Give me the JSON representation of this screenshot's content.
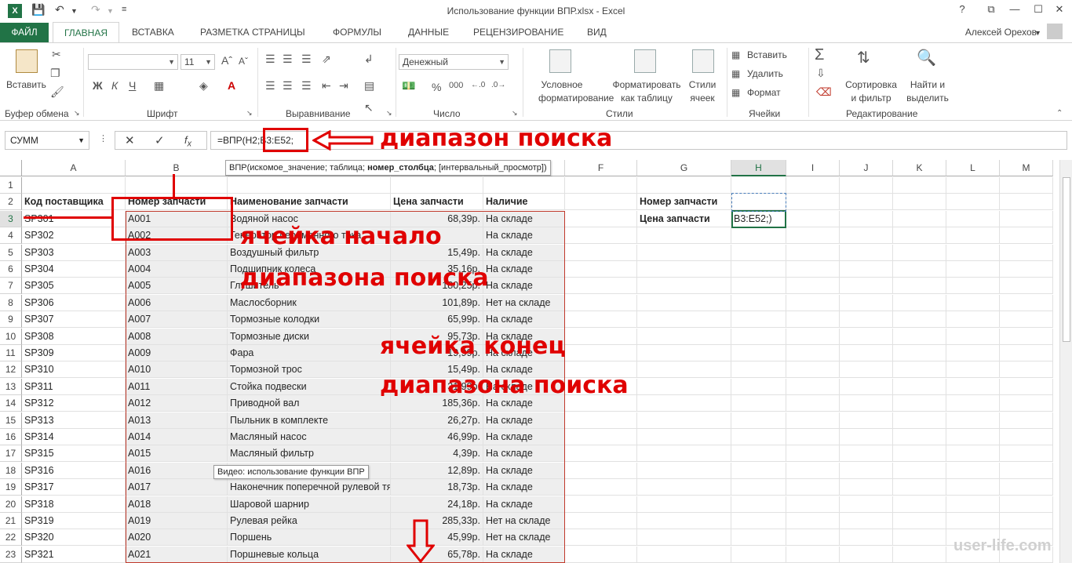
{
  "window": {
    "title": "Использование функции ВПР.xlsx - Excel",
    "app_badge": "X",
    "controls": [
      "?",
      "⧉",
      "—",
      "☐",
      "✕"
    ]
  },
  "tabs": {
    "file": "ФАЙЛ",
    "active": "ГЛАВНАЯ",
    "items": [
      "ВСТАВКА",
      "РАЗМЕТКА СТРАНИЦЫ",
      "ФОРМУЛЫ",
      "ДАННЫЕ",
      "РЕЦЕНЗИРОВАНИЕ",
      "ВИД"
    ],
    "user": "Алексей Орехов"
  },
  "ribbon": {
    "clipboard": {
      "paste": "Вставить",
      "label": "Буфер обмена"
    },
    "font": {
      "size": "11",
      "label": "Шрифт",
      "bold": "Ж",
      "italic": "К",
      "underline": "Ч"
    },
    "alignment": {
      "label": "Выравнивание"
    },
    "number": {
      "format": "Денежный",
      "label": "Число",
      "percent": "%",
      "thousands": "000"
    },
    "styles": {
      "conditional": "Условное форматирование",
      "as_table": "Форматировать как таблицу",
      "cell_styles": "Стили ячеек",
      "label": "Стили"
    },
    "cells": {
      "insert": "Вставить",
      "delete": "Удалить",
      "format": "Формат",
      "label": "Ячейки"
    },
    "editing": {
      "sort": "Сортировка и фильтр",
      "find": "Найти и выделить",
      "label": "Редактирование"
    }
  },
  "formula_bar": {
    "name_box": "СУММ",
    "formula_prefix": "=ВПР(H2;",
    "formula_range": "B3:E52;",
    "tooltip_pre": "ВПР(искомое_значение; таблица; ",
    "tooltip_bold": "номер_столбца",
    "tooltip_post": "; [интервальный_просмотр])"
  },
  "columns": [
    "A",
    "B",
    "C",
    "D",
    "E",
    "F",
    "G",
    "H",
    "I",
    "J",
    "K",
    "L",
    "M"
  ],
  "headers": {
    "a": "Код поставщика",
    "b": "Номер запчасти",
    "c": "Наименование запчасти",
    "d": "Цена запчасти",
    "e": "Наличие"
  },
  "side": {
    "g2": "Номер запчасти",
    "g3": "Цена запчасти",
    "h3": "B3:E52;)"
  },
  "rows": [
    [
      "SP301",
      "A001",
      "Водяной насос",
      "68,39р.",
      "На складе"
    ],
    [
      "SP302",
      "A002",
      "Генератор переменного тока",
      "",
      "На складе"
    ],
    [
      "SP303",
      "A003",
      "Воздушный фильтр",
      "15,49р.",
      "На складе"
    ],
    [
      "SP304",
      "A004",
      "Подшипник колеса",
      "35,16р.",
      "На складе"
    ],
    [
      "SP305",
      "A005",
      "Глушитель",
      "180,25р.",
      "На складе"
    ],
    [
      "SP306",
      "A006",
      "Маслосборник",
      "101,89р.",
      "Нет на складе"
    ],
    [
      "SP307",
      "A007",
      "Тормозные колодки",
      "65,99р.",
      "На складе"
    ],
    [
      "SP308",
      "A008",
      "Тормозные диски",
      "95,73р.",
      "На складе"
    ],
    [
      "SP309",
      "A009",
      "Фара",
      "19,99р.",
      "На складе"
    ],
    [
      "SP310",
      "A010",
      "Тормозной трос",
      "15,49р.",
      "На складе"
    ],
    [
      "SP311",
      "A011",
      "Стойка подвески",
      "31,99р.",
      "На складе"
    ],
    [
      "SP312",
      "A012",
      "Приводной вал",
      "185,36р.",
      "На складе"
    ],
    [
      "SP313",
      "A013",
      "Пыльник в комплекте",
      "26,27р.",
      "На складе"
    ],
    [
      "SP314",
      "A014",
      "Масляный насос",
      "46,99р.",
      "На складе"
    ],
    [
      "SP315",
      "A015",
      "Масляный фильтр",
      "4,39р.",
      "На складе"
    ],
    [
      "SP316",
      "A016",
      "",
      "12,89р.",
      "На складе"
    ],
    [
      "SP317",
      "A017",
      "Наконечник поперечной рулевой тяги",
      "18,73р.",
      "На складе"
    ],
    [
      "SP318",
      "A018",
      "Шаровой шарнир",
      "24,18р.",
      "На складе"
    ],
    [
      "SP319",
      "A019",
      "Рулевая рейка",
      "285,33р.",
      "Нет на складе"
    ],
    [
      "SP320",
      "A020",
      "Поршень",
      "45,99р.",
      "Нет на складе"
    ],
    [
      "SP321",
      "A021",
      "Поршневые кольца",
      "65,78р.",
      "На складе"
    ]
  ],
  "annotations": {
    "search_range": "диапазон поиска",
    "start_1": "ячейка начало",
    "start_2": "диапазона поиска",
    "end_1": "ячейка конец",
    "end_2": "диапазона поиска"
  },
  "video_tip": "Видео: использование функции ВПР",
  "watermark": "user-life.com"
}
